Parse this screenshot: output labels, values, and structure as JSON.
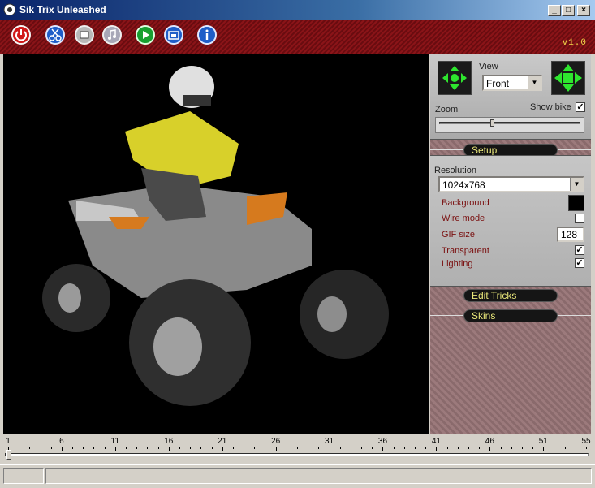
{
  "window": {
    "title": "Sik Trix Unleashed",
    "minimize": "_",
    "maximize": "□",
    "close": "×"
  },
  "toolbar": {
    "version": "v1.0",
    "buttons": [
      "power-icon",
      "cut-icon",
      "open-icon",
      "music-icon",
      "play-icon",
      "screenshot-icon",
      "info-icon"
    ]
  },
  "view": {
    "label": "View",
    "selected": "Front",
    "zoom_label": "Zoom",
    "show_bike_label": "Show bike",
    "show_bike": true,
    "zoom_level": 0.37
  },
  "setup": {
    "header": "Setup",
    "resolution_label": "Resolution",
    "resolution": "1024x768",
    "background_label": "Background",
    "background_color": "#000000",
    "wire_mode_label": "Wire  mode",
    "wire_mode": false,
    "gif_size_label": "GIF size",
    "gif_size": "128",
    "transparent_label": "Transparent",
    "transparent": true,
    "lighting_label": "Lighting",
    "lighting": true
  },
  "sections": {
    "edit_tricks": "Edit Tricks",
    "skins": "Skins"
  },
  "timeline": {
    "ticks": [
      "1",
      "6",
      "11",
      "16",
      "21",
      "26",
      "31",
      "36",
      "41",
      "46",
      "51",
      "55"
    ],
    "position": 1
  },
  "colors": {
    "accent": "#8a1418",
    "pill_text": "#e9e77a",
    "label_red": "#7a1010"
  }
}
